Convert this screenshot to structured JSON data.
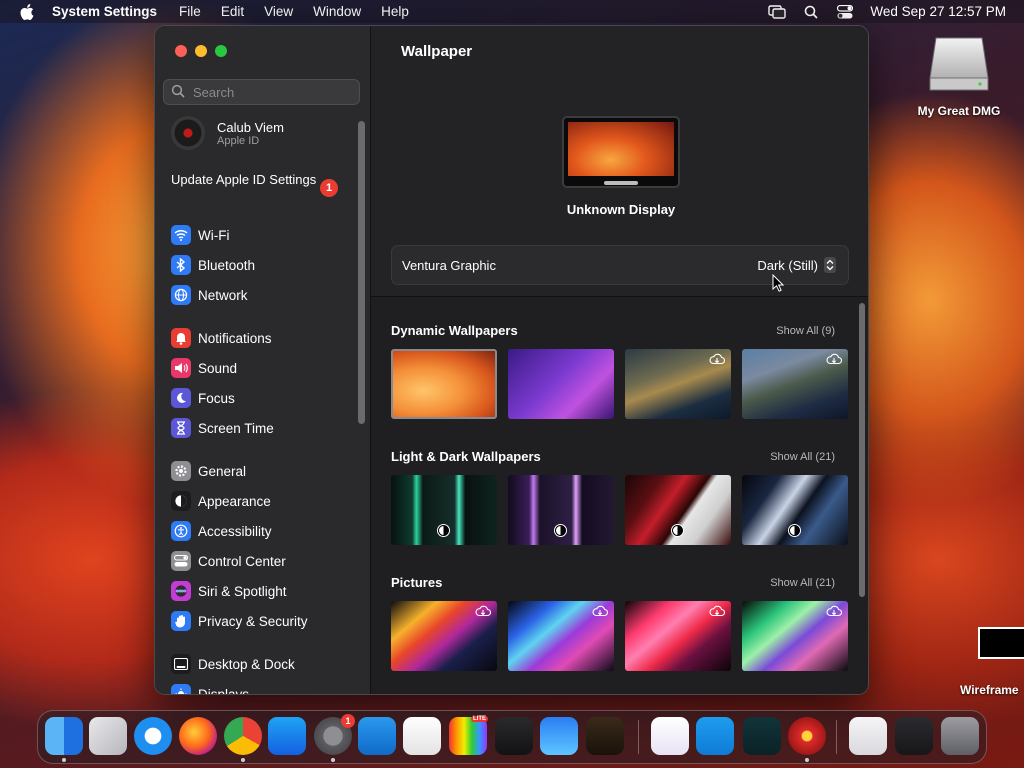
{
  "menubar": {
    "app_name": "System Settings",
    "menus": [
      "File",
      "Edit",
      "View",
      "Window",
      "Help"
    ],
    "datetime": "Wed Sep 27  12:57 PM"
  },
  "desktop": {
    "disk_label": "My Great DMG",
    "wireframe_label": "Wireframe"
  },
  "sidebar": {
    "search_placeholder": "Search",
    "account": {
      "name": "Calub Viem",
      "subtitle": "Apple ID"
    },
    "update": {
      "label": "Update Apple ID Settings",
      "badge": "1"
    },
    "groups": [
      [
        {
          "label": "Wi-Fi",
          "icon": "wifi-icon",
          "color": "#2f7bf6"
        },
        {
          "label": "Bluetooth",
          "icon": "bluetooth-icon",
          "color": "#2f7bf6"
        },
        {
          "label": "Network",
          "icon": "globe-icon",
          "color": "#2f7bf6"
        }
      ],
      [
        {
          "label": "Notifications",
          "icon": "bell-icon",
          "color": "#ea3c32"
        },
        {
          "label": "Sound",
          "icon": "speaker-icon",
          "color": "#e8386a"
        },
        {
          "label": "Focus",
          "icon": "moon-icon",
          "color": "#5b57d6"
        },
        {
          "label": "Screen Time",
          "icon": "hourglass-icon",
          "color": "#5b57d6"
        }
      ],
      [
        {
          "label": "General",
          "icon": "gear-icon",
          "color": "#8e8e93"
        },
        {
          "label": "Appearance",
          "icon": "appearance-icon",
          "color": "#1c1c1e"
        },
        {
          "label": "Accessibility",
          "icon": "accessibility-icon",
          "color": "#2f7bf6"
        },
        {
          "label": "Control Center",
          "icon": "control-center-icon",
          "color": "#8e8e93"
        },
        {
          "label": "Siri & Spotlight",
          "icon": "siri-icon",
          "color": "#c43bd6"
        },
        {
          "label": "Privacy & Security",
          "icon": "hand-icon",
          "color": "#2f7bf6"
        }
      ],
      [
        {
          "label": "Desktop & Dock",
          "icon": "dock-icon",
          "color": "#1c1c1e"
        },
        {
          "label": "Displays",
          "icon": "display-icon",
          "color": "#2f7bf6"
        }
      ]
    ]
  },
  "content": {
    "title": "Wallpaper",
    "display_name": "Unknown Display",
    "current_wallpaper": "Ventura Graphic",
    "appearance_value": "Dark (Still)",
    "sections": [
      {
        "title": "Dynamic Wallpapers",
        "show_all": "Show All (9)"
      },
      {
        "title": "Light & Dark Wallpapers",
        "show_all": "Show All (21)"
      },
      {
        "title": "Pictures",
        "show_all": "Show All (21)"
      }
    ]
  },
  "dock": {
    "apps": [
      "Finder",
      "Launchpad",
      "Safari",
      "Firefox",
      "Chrome",
      "App Store",
      "System Settings",
      "VS Code",
      "TextEdit",
      "Affinity",
      "Terminal",
      "Weather",
      "Instruments",
      "Visual Studio",
      "Visual Code Remote",
      "Wireframe App",
      "Flash",
      "Preview",
      "Window Stack",
      "Trash"
    ],
    "system_settings_badge": "1",
    "lite_badge": "LITE"
  },
  "colors": {
    "accent": "#2f7bf6",
    "badge": "#ea3c32"
  }
}
